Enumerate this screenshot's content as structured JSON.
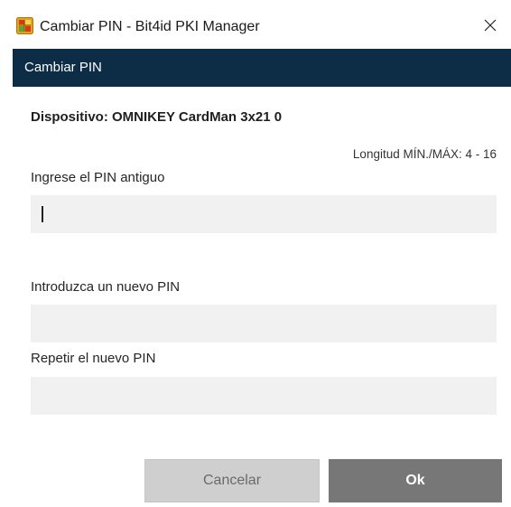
{
  "window": {
    "title": "Cambiar PIN - Bit4id PKI Manager",
    "app_icon": "bit4id-card-icon",
    "close_icon": "close-icon"
  },
  "header": {
    "title": "Cambiar PIN",
    "background": "#0c2d45"
  },
  "device": {
    "label": "Dispositivo: OMNIKEY CardMan 3x21 0"
  },
  "length_note": "Longitud MÍN./MÁX: 4 - 16",
  "fields": {
    "old_pin": {
      "label": "Ingrese el PIN antiguo",
      "value": "",
      "focused": true
    },
    "new_pin": {
      "label": "Introduzca un nuevo PIN",
      "value": ""
    },
    "repeat_pin": {
      "label": "Repetir el nuevo PIN",
      "value": ""
    }
  },
  "buttons": {
    "cancel": "Cancelar",
    "ok": "Ok"
  },
  "colors": {
    "header_bg": "#0c2d45",
    "field_bg": "#f1f1f1",
    "cancel_bg": "#cfcfcf",
    "ok_bg": "#777777"
  }
}
